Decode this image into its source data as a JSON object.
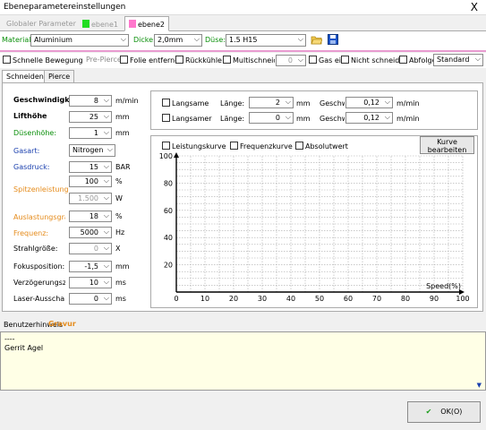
{
  "window": {
    "title": "Ebeneparametereinstellungen",
    "close": "X"
  },
  "top_tabs": [
    {
      "label": "Globaler Parameter",
      "color": ""
    },
    {
      "label": "ebene1",
      "color": "#22dd22"
    },
    {
      "label": "ebene2",
      "color": "#ff77cc"
    }
  ],
  "top_row": {
    "material_label": "Material:",
    "material_value": "Aluminium",
    "dicke_label": "Dicke:",
    "dicke_value": "2,0mm",
    "duese_label": "Düse:",
    "duese_value": "1.5 H15"
  },
  "options": {
    "schnelle": "Schnelle Bewegung",
    "prepierce": "Pre-Pierce",
    "folie": "Folie entfernen",
    "rueckkuehl": "Rückkühlen",
    "multi": "Multischneiden",
    "multi_value": "0",
    "gas": "Gas ein",
    "nicht": "Nicht schneiden",
    "abfolge": "Abfolge",
    "mode": "Standard"
  },
  "inner_tabs": [
    "Schneiden",
    "Pierce"
  ],
  "params": [
    {
      "label": "Geschwindigkeit",
      "value": "8",
      "unit": "m/min"
    },
    {
      "label": "Lifthöhe",
      "value": "25",
      "unit": "mm"
    },
    {
      "label": "Düsenhöhe:",
      "value": "1",
      "unit": "mm"
    },
    {
      "label": "Gasart:",
      "value": "Nitrogen",
      "unit": ""
    },
    {
      "label": "Gasdruck:",
      "value": "15",
      "unit": "BAR"
    },
    {
      "label": "Spitzenleistung:",
      "value": "100",
      "unit": "%"
    },
    {
      "label": "",
      "value": "1.500",
      "unit": "W"
    },
    {
      "label": "Auslastungsgrad",
      "value": "18",
      "unit": "%"
    },
    {
      "label": "Frequenz:",
      "value": "5000",
      "unit": "Hz"
    },
    {
      "label": "Strahlgröße:",
      "value": "0",
      "unit": "X"
    },
    {
      "label": "Fokusposition:",
      "value": "-1,5",
      "unit": "mm"
    },
    {
      "label": "Verzögerungszeit",
      "value": "10",
      "unit": "ms"
    },
    {
      "label": "Laser-Ausschaltzeit",
      "value": "0",
      "unit": "ms"
    }
  ],
  "slow": [
    {
      "label": "Langsame",
      "len_label": "Länge:",
      "len_value": "2",
      "len_unit": "mm",
      "spd_label": "Geschwindigkeit",
      "spd_value": "0,12",
      "spd_unit": "m/min"
    },
    {
      "label": "Langsamer",
      "len_label": "Länge:",
      "len_value": "0",
      "len_unit": "mm",
      "spd_label": "Geschwindigkeit",
      "spd_value": "0,12",
      "spd_unit": "m/min"
    }
  ],
  "curve": {
    "leistung": "Leistungskurve",
    "frequenz": "Frequenzkurve",
    "absolut": "Absolutwert",
    "edit_btn": "Kurve bearbeiten",
    "x_ticks": [
      "0",
      "10",
      "20",
      "30",
      "40",
      "50",
      "60",
      "70",
      "80",
      "90",
      "100"
    ],
    "y_ticks": [
      "20",
      "40",
      "60",
      "80",
      "100"
    ],
    "x_label": "Speed(%)"
  },
  "chart_data": {
    "type": "line",
    "xlabel": "Speed(%)",
    "ylabel": "",
    "xlim": [
      0,
      100
    ],
    "ylim": [
      0,
      100
    ],
    "grid": true,
    "series": []
  },
  "notes": {
    "header": "Benutzerhinweis",
    "overlay": "Gravur",
    "lines": [
      "----",
      "Gerrit Agel"
    ]
  },
  "footer": {
    "ok": "OK(O)"
  }
}
